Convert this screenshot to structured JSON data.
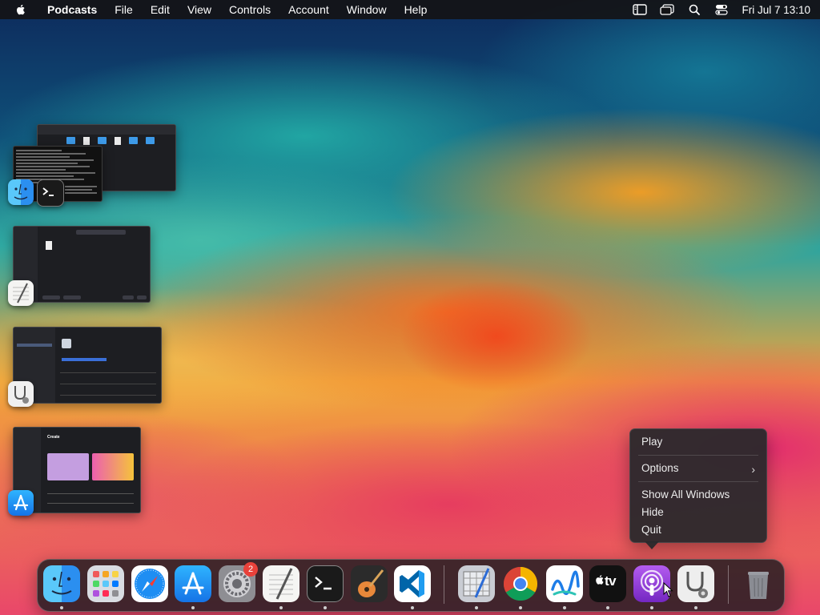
{
  "menubar": {
    "app_name": "Podcasts",
    "items": [
      "File",
      "Edit",
      "View",
      "Controls",
      "Account",
      "Window",
      "Help"
    ],
    "status_icons": [
      "sidebar-toggle-icon",
      "window-icon",
      "spotlight-search-icon",
      "control-center-icon"
    ],
    "clock": "Fri Jul 7  13:10"
  },
  "expose_windows": [
    {
      "app": "Finder + Terminal",
      "badges": [
        "finder-icon",
        "terminal-icon"
      ]
    },
    {
      "app": "TextEdit",
      "badges": [
        "textedit-icon"
      ]
    },
    {
      "app": "System Information",
      "badges": [
        "system-information-icon"
      ]
    },
    {
      "app": "App Store",
      "badges": [
        "app-store-icon"
      ],
      "heading": "Create"
    }
  ],
  "context_menu": {
    "items": {
      "play": "Play",
      "options": "Options",
      "show_all_windows": "Show All Windows",
      "hide": "Hide",
      "quit": "Quit"
    },
    "submenu_chevron": "›"
  },
  "dock": {
    "apps": [
      {
        "name": "Finder",
        "icon": "finder-icon",
        "running": true
      },
      {
        "name": "Launchpad",
        "icon": "launchpad-icon",
        "running": false
      },
      {
        "name": "Safari",
        "icon": "safari-icon",
        "running": false
      },
      {
        "name": "App Store",
        "icon": "app-store-icon",
        "running": true
      },
      {
        "name": "System Settings",
        "icon": "system-settings-icon",
        "running": false,
        "badge": "2"
      },
      {
        "name": "TextEdit",
        "icon": "textedit-icon",
        "running": true
      },
      {
        "name": "Terminal",
        "icon": "terminal-icon",
        "running": true
      },
      {
        "name": "GarageBand",
        "icon": "garageband-icon",
        "running": false
      },
      {
        "name": "Visual Studio Code",
        "icon": "vscode-icon",
        "running": true
      },
      {
        "name": "Script Editor",
        "icon": "script-editor-icon",
        "running": true
      },
      {
        "name": "Google Chrome",
        "icon": "chrome-icon",
        "running": true
      },
      {
        "name": "Freeform",
        "icon": "freeform-icon",
        "running": true
      },
      {
        "name": "Apple TV",
        "icon": "apple-tv-icon",
        "running": true
      },
      {
        "name": "Podcasts",
        "icon": "podcasts-icon",
        "running": true
      },
      {
        "name": "System Information",
        "icon": "system-information-icon",
        "running": true
      },
      {
        "name": "Trash",
        "icon": "trash-icon",
        "running": false
      }
    ],
    "tv_label": "tv",
    "settings_badge": "2"
  },
  "colors": {
    "menubar_bg": "#141416",
    "menu_bg": "#28282c",
    "badge_red": "#e8413a",
    "podcasts_purple": "#8f3ccf"
  }
}
